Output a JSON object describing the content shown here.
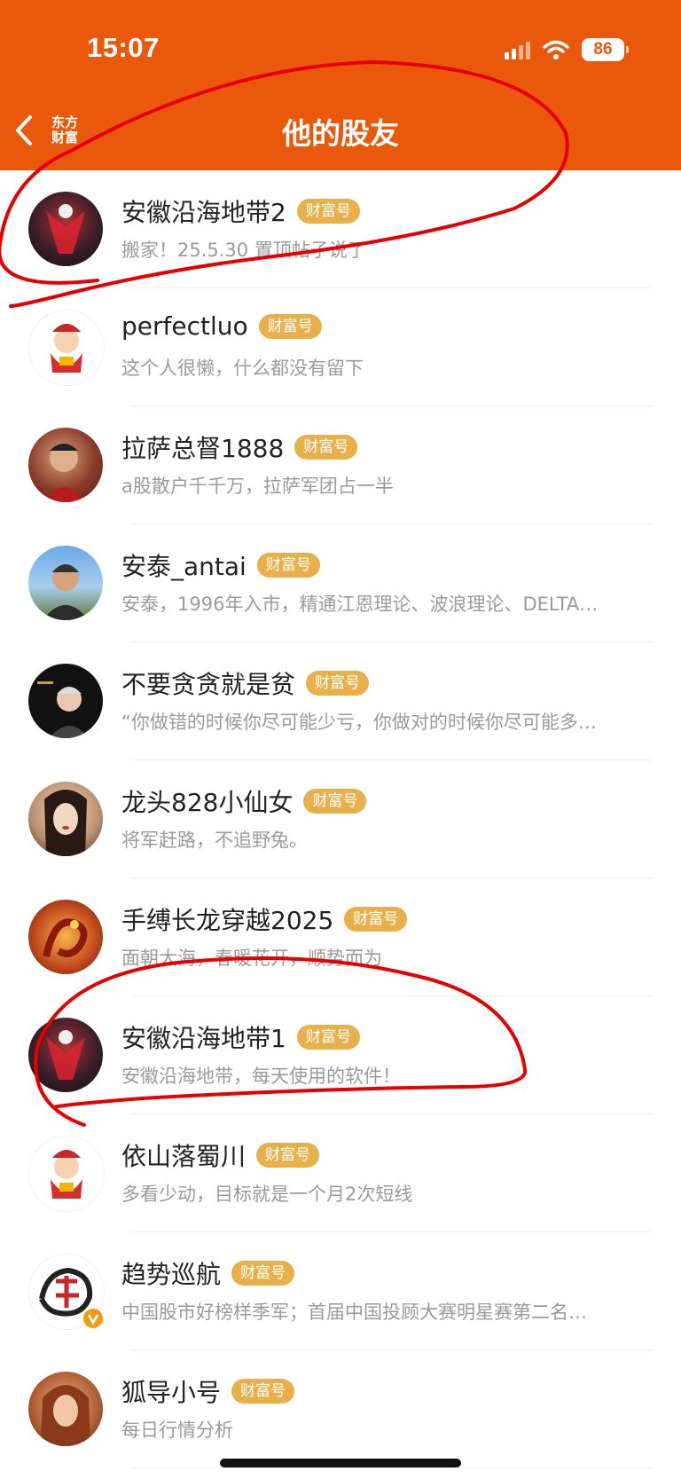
{
  "status_bar": {
    "time": "15:07",
    "battery": "86"
  },
  "header": {
    "logo": "东方财富",
    "title": "他的股友"
  },
  "friends": [
    {
      "name": "安徽沿海地带2",
      "badge": "财富号",
      "bio": "搬家！25.5.30   置顶帖子说了"
    },
    {
      "name": "perfectluo",
      "badge": "财富号",
      "bio": "这个人很懒，什么都没有留下"
    },
    {
      "name": "拉萨总督1888",
      "badge": "财富号",
      "bio": "a股散户千千万，拉萨军团占一半"
    },
    {
      "name": "安泰_antai",
      "badge": "财富号",
      "bio": "安泰，1996年入市，精通江恩理论、波浪理论、DELTA…"
    },
    {
      "name": "不要贪贪就是贫",
      "badge": "财富号",
      "bio": "“你做错的时候你尽可能少亏，你做对的时候你尽可能多…"
    },
    {
      "name": "龙头828小仙女",
      "badge": "财富号",
      "bio": "将军赶路，不追野兔。"
    },
    {
      "name": "手缚长龙穿越2025",
      "badge": "财富号",
      "bio": "面朝大海，春暖花开，顺势而为"
    },
    {
      "name": "安徽沿海地带1",
      "badge": "财富号",
      "bio": "安徽沿海地带，每天使用的软件！"
    },
    {
      "name": "依山落蜀川",
      "badge": "财富号",
      "bio": "多看少动，目标就是一个月2次短线"
    },
    {
      "name": "趋势巡航",
      "badge": "财富号",
      "bio": "中国股市好榜样季军；首届中国投顾大赛明星赛第二名…"
    },
    {
      "name": "狐导小号",
      "badge": "财富号",
      "bio": "每日行情分析"
    }
  ],
  "colors": {
    "brand": "#ea580c",
    "badge": "#e7b04a",
    "annotation": "#e60000"
  }
}
